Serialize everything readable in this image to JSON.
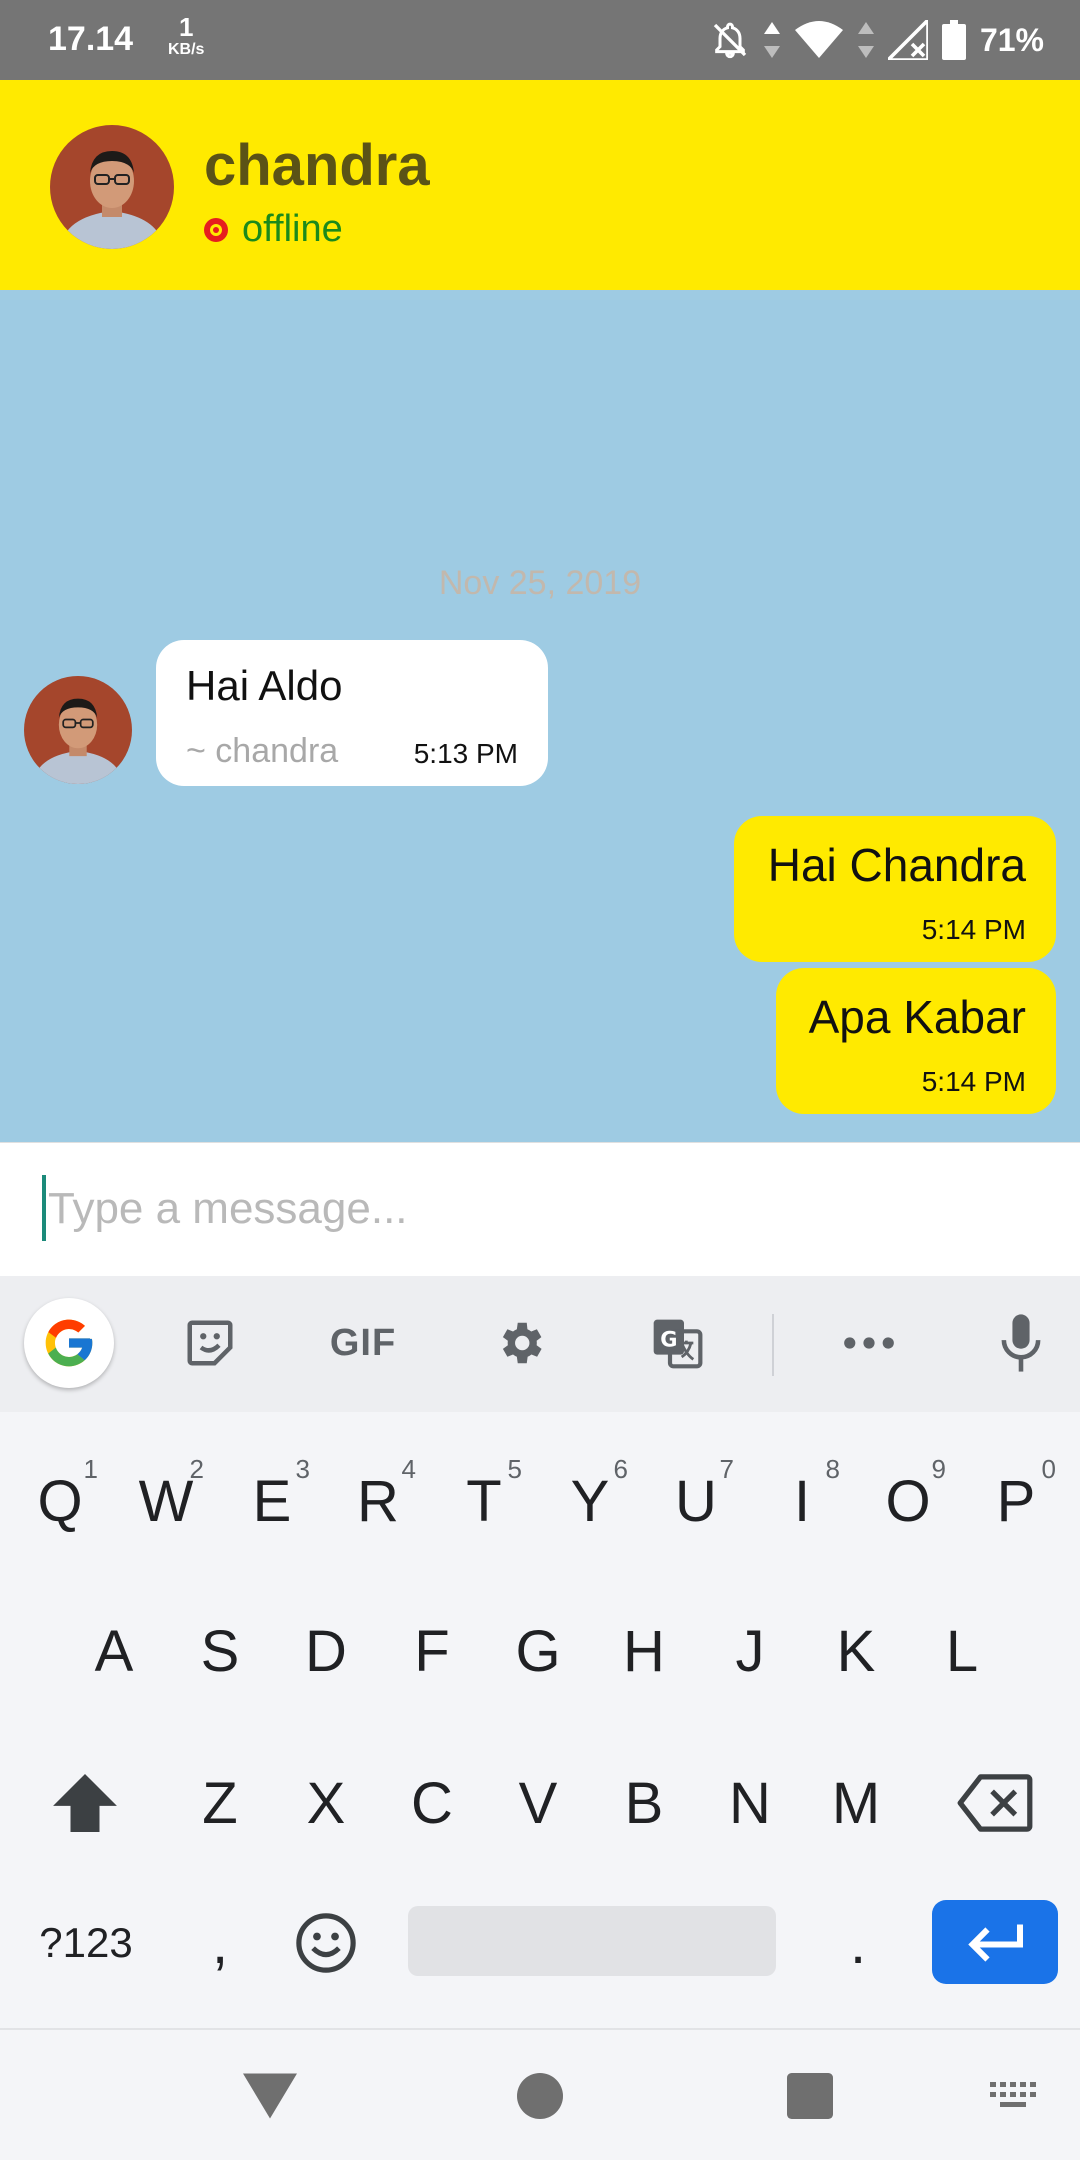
{
  "status_bar": {
    "time": "17.14",
    "net_speed_value": "1",
    "net_speed_unit": "KB/s",
    "battery_percent": "71%"
  },
  "header": {
    "contact_name": "chandra",
    "status": "offline",
    "status_color": "#e61e1e"
  },
  "chat": {
    "date_separator": "Nov 25, 2019",
    "messages": [
      {
        "direction": "incoming",
        "text": "Hai Aldo",
        "sender": "~ chandra",
        "time": "5:13 PM"
      },
      {
        "direction": "outgoing",
        "text": "Hai Chandra",
        "time": "5:14 PM"
      },
      {
        "direction": "outgoing",
        "text": "Apa Kabar",
        "time": "5:14 PM"
      }
    ]
  },
  "composer": {
    "placeholder": "Type a message...",
    "value": ""
  },
  "keyboard": {
    "toolbar": {
      "gif_label": "GIF"
    },
    "rows": [
      [
        {
          "label": "Q",
          "hint": "1"
        },
        {
          "label": "W",
          "hint": "2"
        },
        {
          "label": "E",
          "hint": "3"
        },
        {
          "label": "R",
          "hint": "4"
        },
        {
          "label": "T",
          "hint": "5"
        },
        {
          "label": "Y",
          "hint": "6"
        },
        {
          "label": "U",
          "hint": "7"
        },
        {
          "label": "I",
          "hint": "8"
        },
        {
          "label": "O",
          "hint": "9"
        },
        {
          "label": "P",
          "hint": "0"
        }
      ],
      [
        {
          "label": "A"
        },
        {
          "label": "S"
        },
        {
          "label": "D"
        },
        {
          "label": "F"
        },
        {
          "label": "G"
        },
        {
          "label": "H"
        },
        {
          "label": "J"
        },
        {
          "label": "K"
        },
        {
          "label": "L"
        }
      ],
      [
        {
          "label": "Z"
        },
        {
          "label": "X"
        },
        {
          "label": "C"
        },
        {
          "label": "V"
        },
        {
          "label": "B"
        },
        {
          "label": "N"
        },
        {
          "label": "M"
        }
      ]
    ],
    "symbols_label": "?123",
    "comma_label": ",",
    "period_label": "."
  },
  "colors": {
    "header_bg": "#ffea00",
    "chat_bg": "#9ecbe3",
    "outgoing_bubble": "#ffea00",
    "incoming_bubble": "#ffffff",
    "enter_key": "#1a73e8"
  }
}
